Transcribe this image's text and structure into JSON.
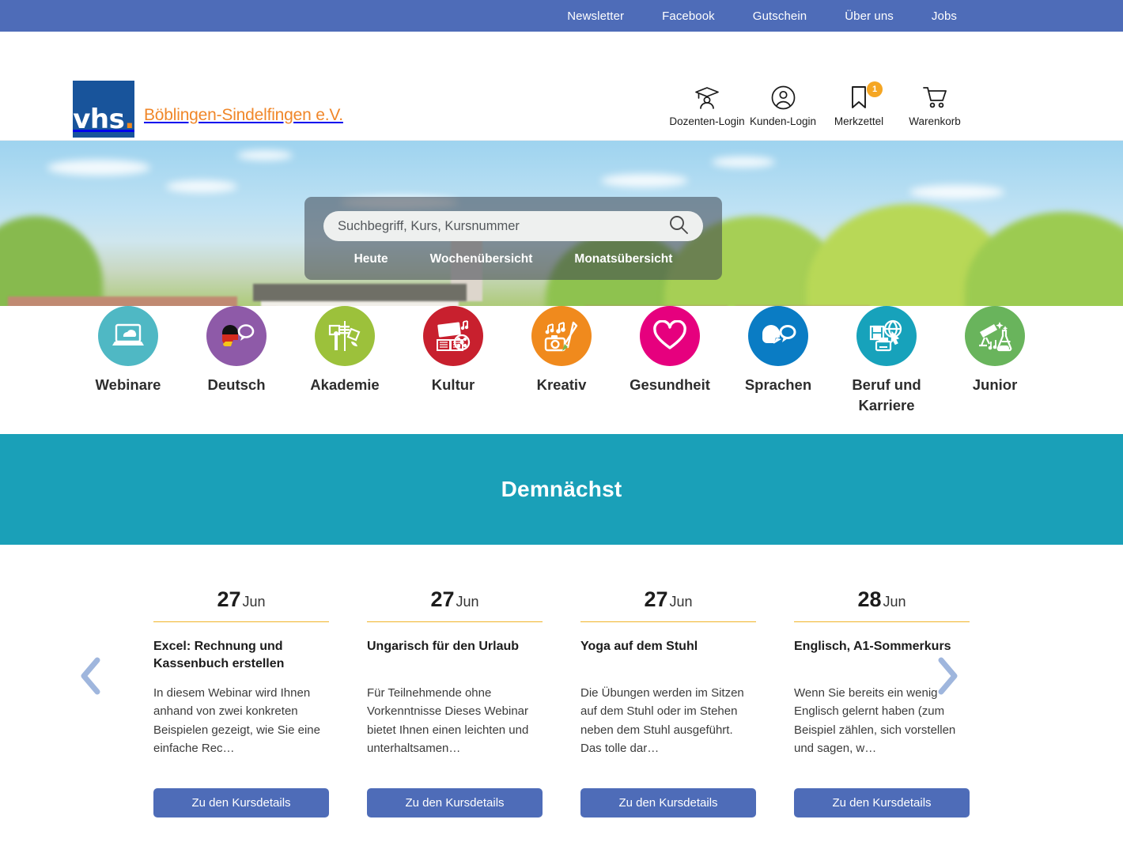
{
  "topbar": {
    "links": [
      {
        "label": "Newsletter"
      },
      {
        "label": "Facebook"
      },
      {
        "label": "Gutschein"
      },
      {
        "label": "Über uns"
      },
      {
        "label": "Jobs"
      }
    ]
  },
  "header": {
    "logo_mark": "vhs",
    "logo_dot": ".",
    "logo_text": "Böblingen-Sindelfingen e.V.",
    "actions": [
      {
        "label": "Dozenten-Login",
        "icon": "graduate-icon"
      },
      {
        "label": "Kunden-Login",
        "icon": "user-circle-icon"
      },
      {
        "label": "Merkzettel",
        "icon": "bookmark-icon",
        "badge": "1"
      },
      {
        "label": "Warenkorb",
        "icon": "cart-icon"
      }
    ]
  },
  "hero": {
    "search": {
      "value": "",
      "placeholder": "Suchbegriff, Kurs, Kursnummer",
      "icon": "search-icon"
    },
    "quick_links": [
      {
        "label": "Heute"
      },
      {
        "label": "Wochenübersicht"
      },
      {
        "label": "Monatsübersicht"
      }
    ]
  },
  "categories": [
    {
      "label": "Webinare",
      "color": "#4fb8c4",
      "icon": "laptop-cloud-icon"
    },
    {
      "label": "Deutsch",
      "color": "#8e5aa8",
      "icon": "german-flag-speech-icon"
    },
    {
      "label": "Akademie",
      "color": "#9cc13b",
      "icon": "tower-art-icon"
    },
    {
      "label": "Kultur",
      "color": "#c8202e",
      "icon": "book-film-music-icon"
    },
    {
      "label": "Kreativ",
      "color": "#f08a1d",
      "icon": "camera-brush-music-icon"
    },
    {
      "label": "Gesundheit",
      "color": "#e6007e",
      "icon": "heart-icon"
    },
    {
      "label": "Sprachen",
      "color": "#0a7cc4",
      "icon": "head-speech-icon"
    },
    {
      "label": "Beruf und Karriere",
      "color": "#17a2bb",
      "icon": "office-globe-printer-icon"
    },
    {
      "label": "Junior",
      "color": "#69b45c",
      "icon": "telescope-flask-icon"
    }
  ],
  "band": {
    "title": "Demnächst"
  },
  "carousel": {
    "prev_icon": "chevron-left-icon",
    "next_icon": "chevron-right-icon",
    "cards": [
      {
        "day": "27",
        "month": "Jun",
        "title": "Excel: Rechnung und Kassenbuch erstellen",
        "description": "In diesem Webinar wird Ihnen anhand von zwei konkreten Beispielen gezeigt, wie Sie eine einfache Rec…",
        "button": "Zu den Kursdetails"
      },
      {
        "day": "27",
        "month": "Jun",
        "title": "Ungarisch für den Urlaub",
        "description": "Für Teilnehmende ohne Vorkenntnisse Dieses Webinar bietet Ihnen einen leichten und unterhaltsamen…",
        "button": "Zu den Kursdetails"
      },
      {
        "day": "27",
        "month": "Jun",
        "title": "Yoga auf dem Stuhl",
        "description": "Die Übungen werden im Sitzen auf dem Stuhl oder im Stehen neben dem Stuhl ausgeführt. Das tolle dar…",
        "button": "Zu den Kursdetails"
      },
      {
        "day": "28",
        "month": "Jun",
        "title": "Englisch, A1-Sommerkurs",
        "description": "Wenn Sie bereits ein wenig Englisch gelernt haben (zum Beispiel zählen, sich vorstellen und sagen, w…",
        "button": "Zu den Kursdetails"
      }
    ]
  },
  "colors": {
    "topbar_blue": "#4e6cb8",
    "logo_blue": "#18549b",
    "logo_orange": "#f0872a",
    "band_teal": "#1aa0b8",
    "button_blue": "#4e6cb8",
    "badge_amber": "#f5a623",
    "date_rule": "#f0b429"
  }
}
